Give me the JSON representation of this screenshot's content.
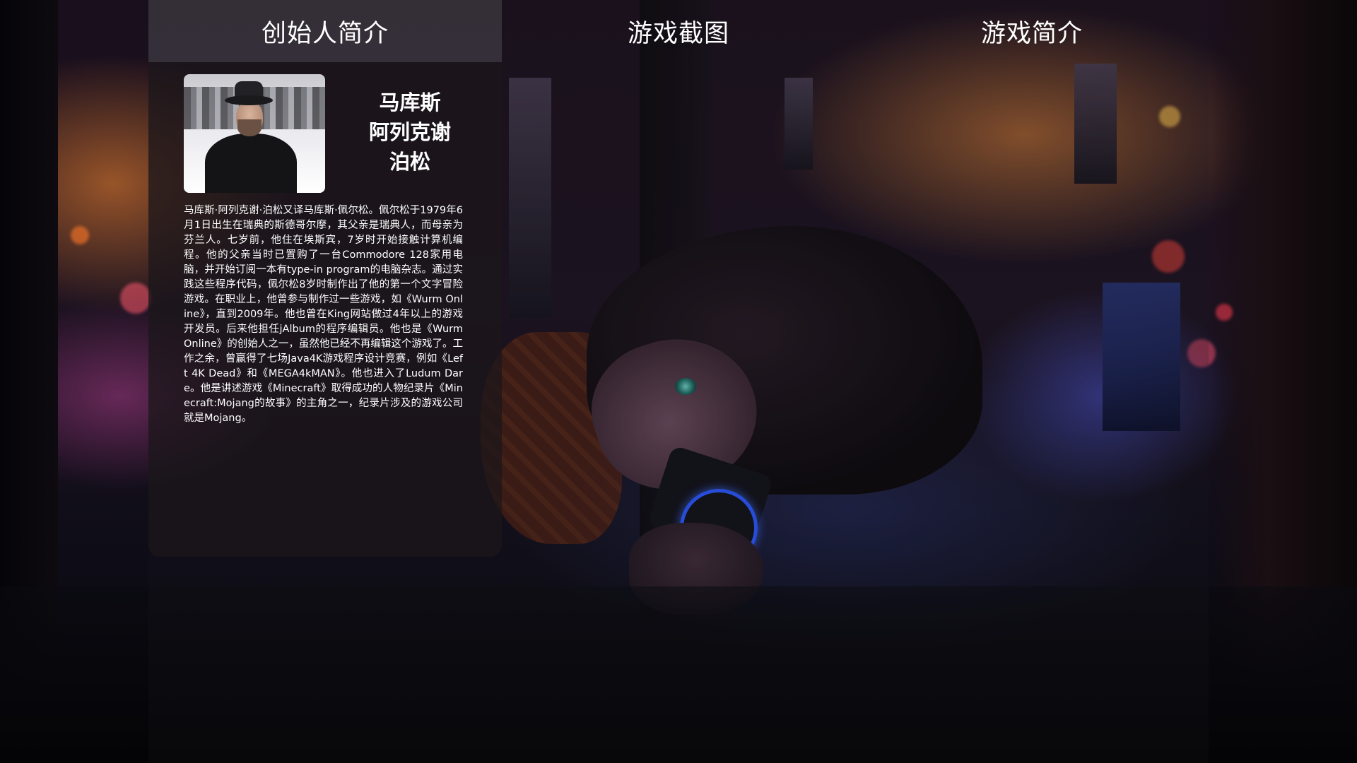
{
  "nav": {
    "tabs": [
      {
        "label": "创始人简介",
        "active": true
      },
      {
        "label": "游戏截图",
        "active": false
      },
      {
        "label": "游戏简介",
        "active": false
      }
    ]
  },
  "founder": {
    "name": "马库斯\n阿列克谢\n泊松",
    "bio": "马库斯·阿列克谢·泊松又译马库斯·佩尔松。佩尔松于1979年6月1日出生在瑞典的斯德哥尔摩，其父亲是瑞典人，而母亲为芬兰人。七岁前，他住在埃斯宾，7岁时开始接触计算机编程。他的父亲当时已置购了一台Commodore 128家用电脑，并开始订阅一本有type-in program的电脑杂志。通过实践这些程序代码，佩尔松8岁时制作出了他的第一个文字冒险游戏。在职业上，他曾参与制作过一些游戏，如《Wurm Online》，直到2009年。他也曾在King网站做过4年以上的游戏开发员。后来他担任jAlbum的程序编辑员。他也是《Wurm Online》的创始人之一，虽然他已经不再编辑这个游戏了。工作之余，曾赢得了七场Java4K游戏程序设计竞赛，例如《Left 4K Dead》和《MEGA4kMAN》。他也进入了Ludum Dare。他是讲述游戏《Minecraft》取得成功的人物纪录片《Minecraft:Mojang的故事》的主角之一，纪录片涉及的游戏公司就是Mojang。",
    "photo_icon": "founder-portrait"
  },
  "colors": {
    "active_tab": "#46424a",
    "card": "#1c161a",
    "text": "#ffffff",
    "phone_glow": "#2a58ff"
  }
}
